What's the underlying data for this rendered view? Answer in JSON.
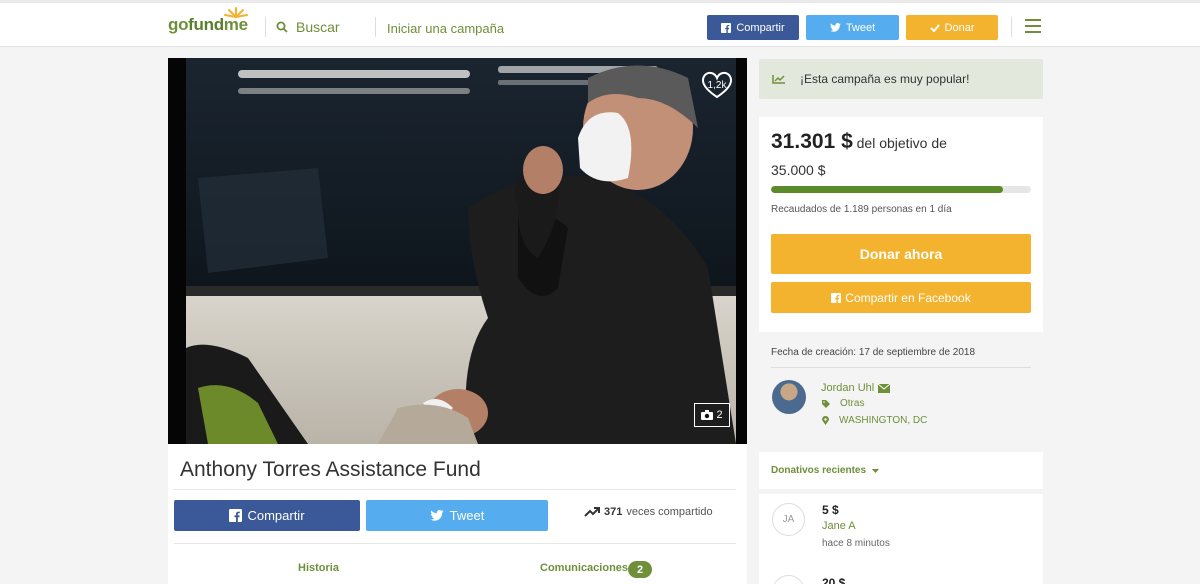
{
  "header": {
    "logo_go": "go",
    "logo_fund": "fund",
    "logo_me": "me",
    "search_label": "Buscar",
    "start_campaign": "Iniciar una campaña",
    "share_label": "Compartir",
    "tweet_label": "Tweet",
    "donate_label": "Donar"
  },
  "hero": {
    "likes": "1,2k",
    "photo_count": "2"
  },
  "campaign": {
    "title": "Anthony Torres Assistance Fund",
    "share_label": "Compartir",
    "tweet_label": "Tweet",
    "share_count": "371",
    "share_count_suffix": "veces compartido",
    "tab_story": "Historia",
    "tab_updates": "Comunicaciones",
    "updates_count": "2"
  },
  "sidebar": {
    "popular_text": "¡Esta campaña es muy popular!",
    "raised_amount": "31.301 $",
    "raised_of": "del objetivo de",
    "goal": "35.000 $",
    "progress_fraction": 0.894,
    "raised_by": "Recaudados de 1.189 personas en 1 día",
    "donate_now": "Donar ahora",
    "share_facebook": "Compartir en Facebook",
    "created": "Fecha de creación: 17 de septiembre de 2018",
    "organizer_name": "Jordan Uhl",
    "category": "Otras",
    "location": "WASHINGTON, DC",
    "recent_title": "Donativos recientes",
    "donations": [
      {
        "initials": "JA",
        "amount": "5 $",
        "name": "Jane A",
        "time": "hace 8 minutos"
      },
      {
        "amount": "20 $"
      }
    ]
  },
  "colors": {
    "brand_green": "#6f8f3a",
    "facebook": "#3b5998",
    "twitter": "#55acee",
    "donate": "#f4b32f"
  }
}
